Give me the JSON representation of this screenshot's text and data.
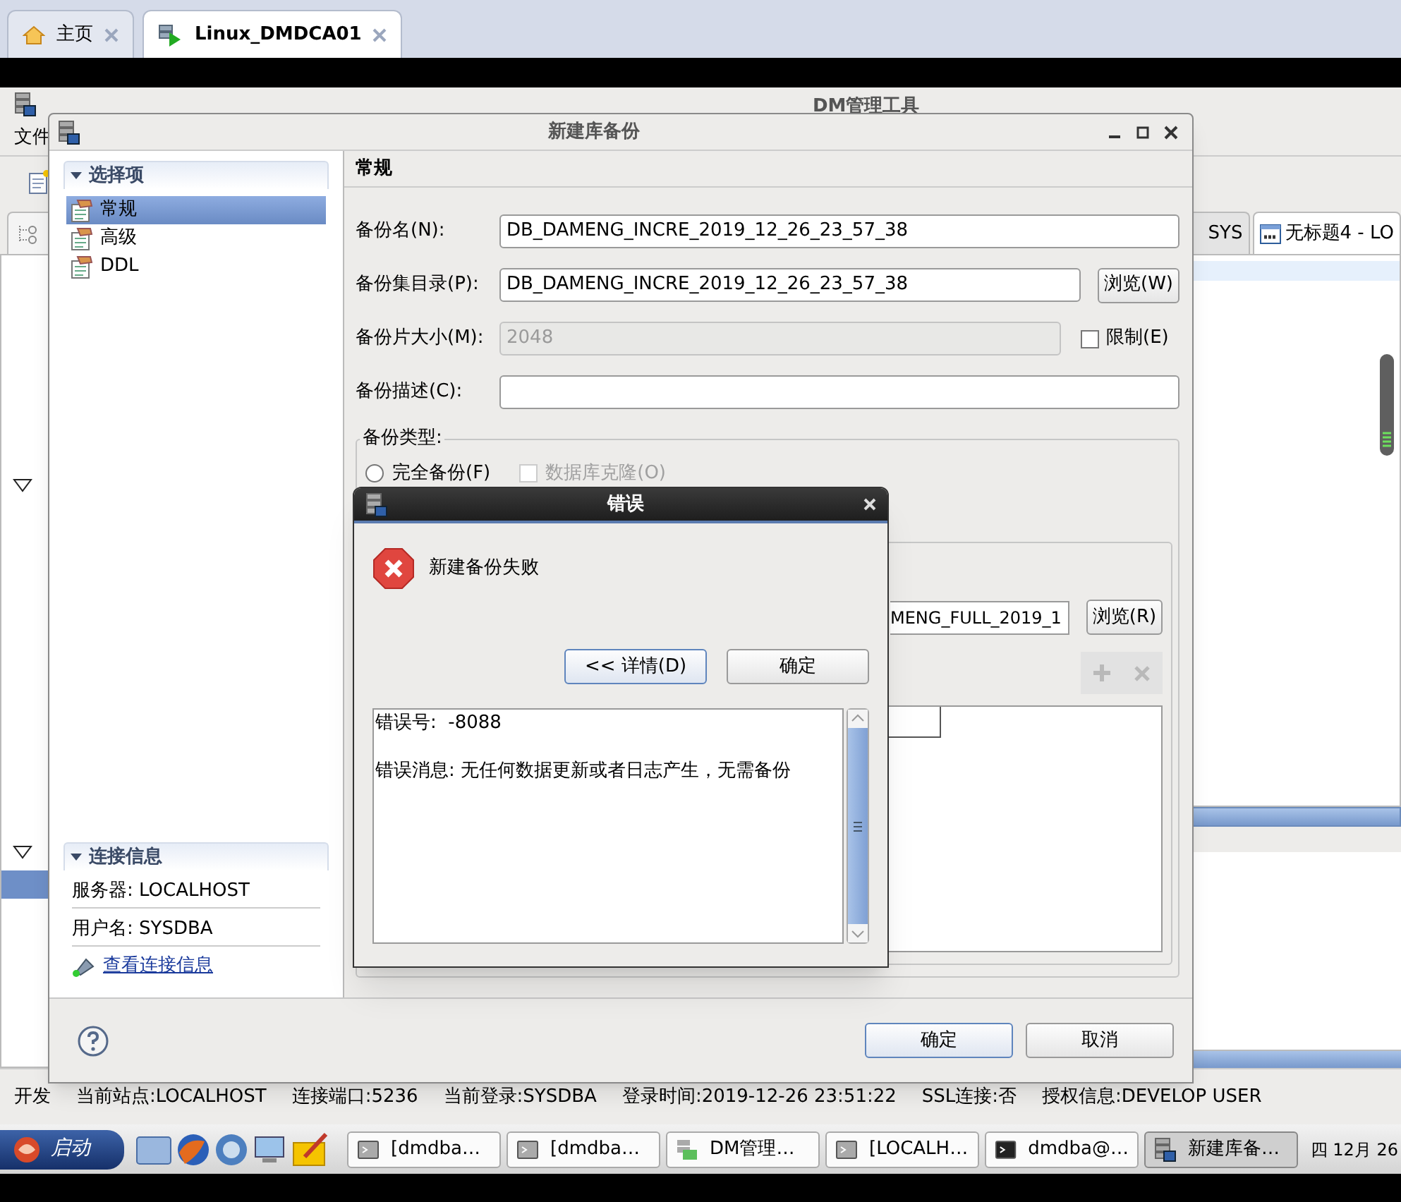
{
  "browser_tabs": [
    {
      "label": "主页",
      "kind": "home",
      "selected": false
    },
    {
      "label": "Linux_DMDCA01",
      "kind": "server",
      "selected": true
    }
  ],
  "app": {
    "title": "DM管理工具",
    "menu": [
      "文件"
    ],
    "editor_tabs": [
      {
        "label": "SYS",
        "kind": "plain",
        "selected": false
      },
      {
        "label": "无标题4 - LO",
        "kind": "sql",
        "selected": true
      }
    ],
    "status_bar": [
      "开发",
      "当前站点:LOCALHOST",
      "连接端口:5236",
      "当前登录:SYSDBA",
      "登录时间:2019-12-26 23:51:22",
      "SSL连接:否",
      "授权信息:DEVELOP USER"
    ]
  },
  "dialog": {
    "title": "新建库备份",
    "sidebar": {
      "title": "选择项",
      "expanded": true,
      "items": [
        {
          "label": "常规",
          "selected": true
        },
        {
          "label": "高级",
          "selected": false
        },
        {
          "label": "DDL",
          "selected": false
        }
      ]
    },
    "connection": {
      "title": "连接信息",
      "expanded": true,
      "rows": [
        "服务器: LOCALHOST",
        "用户名: SYSDBA"
      ],
      "link": "查看连接信息"
    },
    "section_title": "常规",
    "fields": [
      {
        "label": "备份名(N):",
        "value": "DB_DAMENG_INCRE_2019_12_26_23_57_38",
        "disabled": false
      },
      {
        "label": "备份集目录(P):",
        "value": "DB_DAMENG_INCRE_2019_12_26_23_57_38",
        "disabled": false,
        "button": "浏览(W)"
      },
      {
        "label": "备份片大小(M):",
        "value": "2048",
        "disabled": true,
        "checkbox": {
          "label": "限制(E)",
          "checked": false
        }
      },
      {
        "label": "备份描述(C):",
        "disabled": false
      }
    ],
    "backup_type": {
      "legend": "备份类型:",
      "radio": {
        "label": "完全备份(F)",
        "selected": false
      },
      "checkbox": {
        "label": "数据库克隆(O)",
        "checked": false,
        "disabled": true
      }
    },
    "file_field": {
      "value": "MENG_FULL_2019_1",
      "button": "浏览(R)"
    },
    "buttons": [
      {
        "label": "确定",
        "focused": true
      },
      {
        "label": "取消",
        "focused": false
      }
    ]
  },
  "error_dialog": {
    "title": "错误",
    "message": "新建备份失败",
    "buttons": [
      {
        "label": "<< 详情(D)",
        "focused": true
      },
      {
        "label": "确定",
        "focused": false
      }
    ],
    "details": [
      "错误号:  -8088",
      "错误消息: 无任何数据更新或者日志产生，无需备份"
    ]
  },
  "taskbar": {
    "start": "启动",
    "tasks": [
      {
        "label": "[dmdba…",
        "kind": "terminal",
        "selected": false
      },
      {
        "label": "[dmdba…",
        "kind": "terminal",
        "selected": false
      },
      {
        "label": "DM管理…",
        "kind": "app",
        "selected": false
      },
      {
        "label": "[LOCALH…",
        "kind": "terminal",
        "selected": false
      },
      {
        "label": "dmdba@…",
        "kind": "console",
        "selected": false
      },
      {
        "label": "新建库备…",
        "kind": "dialog",
        "selected": true
      }
    ],
    "clock": "四 12月 26"
  }
}
